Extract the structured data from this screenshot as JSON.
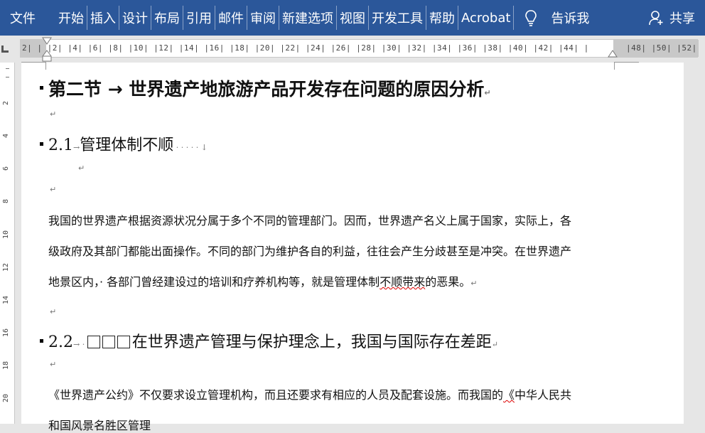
{
  "ribbon": {
    "file_tab": "文件",
    "tabs": [
      "开始",
      "插入",
      "设计",
      "布局",
      "引用",
      "邮件",
      "审阅",
      "新建选项",
      "视图",
      "开发工具",
      "帮助",
      "Acrobat"
    ],
    "tell_me": "告诉我",
    "share": "共享",
    "background_color": "#2b579a"
  },
  "ruler": {
    "left_ticks": "2|   |    |2|   |4|   |6|   |8|   |10|  |12|  |14|  |16|  |18|  |20|  |22|  |24|  |26|  |28|  |30|  |32|  |34|  |36|  |38|  |40|  |42|  |44|   |",
    "right_ticks": "|48|  |50|  |52|",
    "vertical_numbers": [
      "2",
      "4",
      "6",
      "8",
      "10",
      "12",
      "14",
      "16",
      "18",
      "20"
    ]
  },
  "document": {
    "heading1": "第二节 → 世界遗产地旅游产品开发存在问题的原因分析",
    "h21_number": "2.1",
    "h21_text": "管理体制不顺",
    "para1_line1": "我国的世界遗产根据资源状况分属于多个不同的管理部门。因而，世界遗产名义上属于国家，实际上，各",
    "para1_line2": "级政府及其部门都能出面操作。不同的部门为维护各自的利益，往往会产生分歧甚至是冲突。在世界遗产",
    "para1_line3_a": "地景区内，· 各部门曾经建设过的培训和疗养机构等，就是管理体制",
    "para1_line3_err": "不顺带来",
    "para1_line3_b": "的恶果。",
    "h22_number": "2.2",
    "h22_text": "在世界遗产管理与保护理念上，我国与国际存在差距",
    "para2_line1_a": "《世界遗产公约》不仅要求设立管理机构，而且还要求有相应的人员及配套设施。而我国的",
    "para2_line1_err": "《",
    "para2_line1_b": "中华人民共",
    "para2_line2": "和国风景名胜区管理",
    "para_mark": "↵",
    "tab_arrow": "→"
  }
}
